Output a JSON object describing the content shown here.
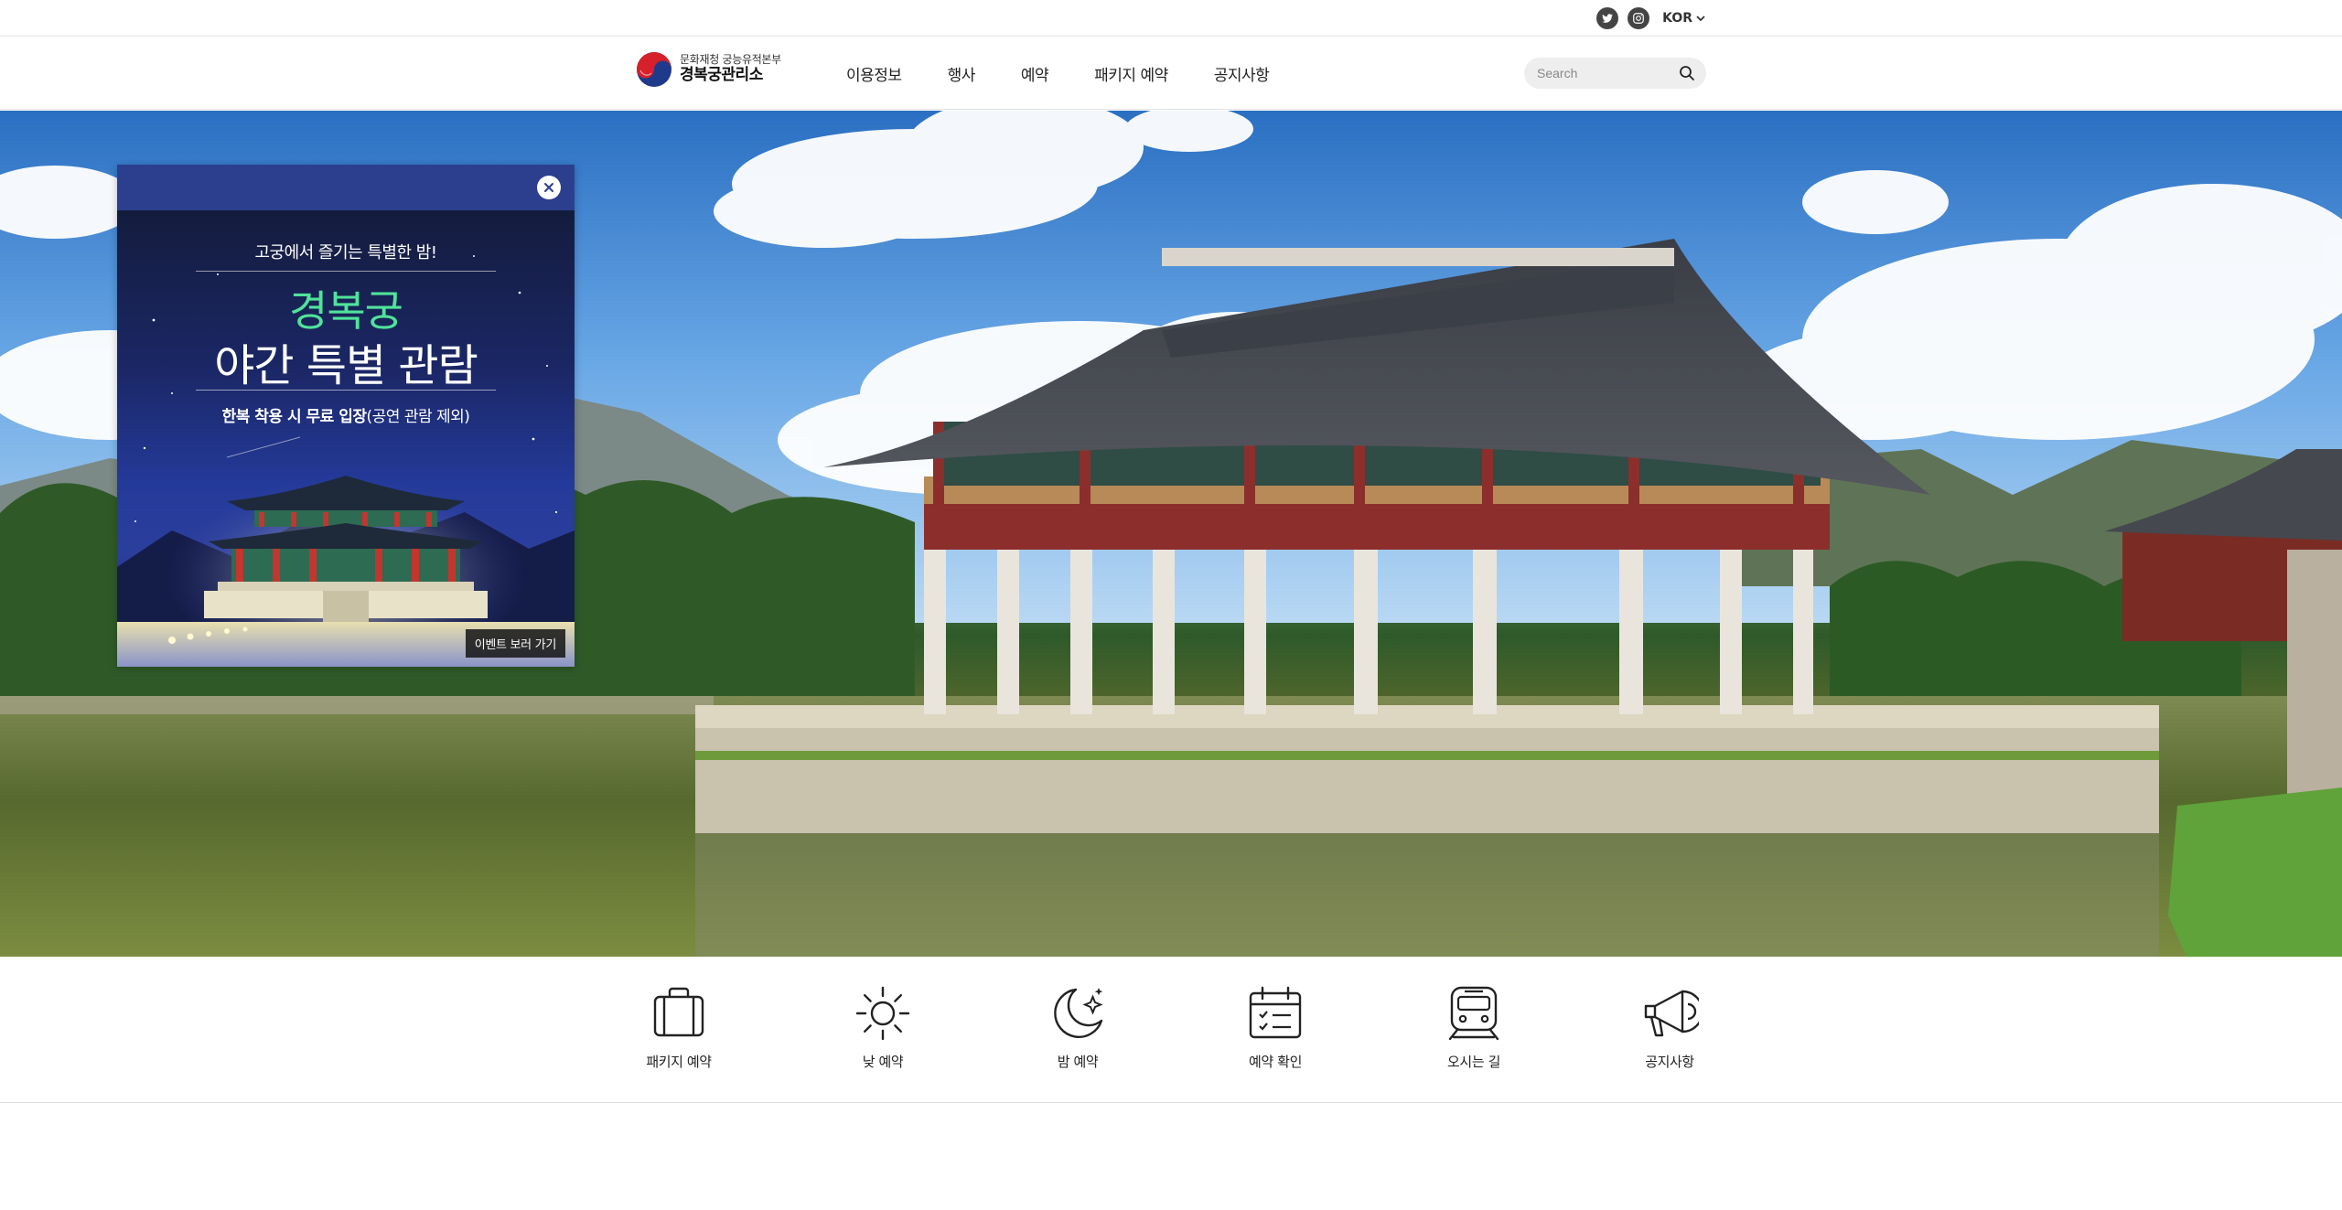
{
  "top_util": {
    "twitter_icon": "twitter-icon",
    "instagram_icon": "instagram-icon",
    "language": "KOR"
  },
  "header": {
    "logo_sub": "문화재청 궁능유적본부",
    "logo_main": "경복궁관리소",
    "nav": [
      "이용정보",
      "행사",
      "예약",
      "패키지 예약",
      "공지사항"
    ],
    "search_placeholder": "Search"
  },
  "popup": {
    "tagline": "고궁에서 즐기는 특별한 밤!",
    "title_line1": "경복궁",
    "title_line2": "야간 특별 관람",
    "subtitle_bold": "한복 착용 시 무료 입장",
    "subtitle_rest": "(공연 관람 제외)",
    "event_button": "이벤트 보러 가기"
  },
  "quick_menu": [
    {
      "label": "패키지 예약",
      "icon": "suitcase-icon"
    },
    {
      "label": "낮 예약",
      "icon": "sun-icon"
    },
    {
      "label": "밤 예약",
      "icon": "moon-icon"
    },
    {
      "label": "예약 확인",
      "icon": "calendar-check-icon"
    },
    {
      "label": "오시는 길",
      "icon": "train-icon"
    },
    {
      "label": "공지사항",
      "icon": "megaphone-icon"
    }
  ],
  "colors": {
    "popup_header": "#2c3f8f",
    "popup_title_accent": "#4fe39a",
    "search_bg": "#eeeeee"
  }
}
